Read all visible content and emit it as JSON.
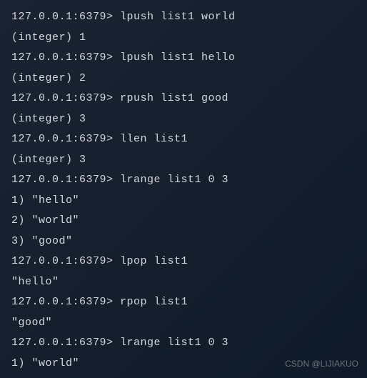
{
  "lines": [
    "127.0.0.1:6379> lpush list1 world",
    "(integer) 1",
    "127.0.0.1:6379> lpush list1 hello",
    "(integer) 2",
    "127.0.0.1:6379> rpush list1 good",
    "(integer) 3",
    "127.0.0.1:6379> llen list1",
    "(integer) 3",
    "127.0.0.1:6379> lrange list1 0 3",
    "1) \"hello\"",
    "2) \"world\"",
    "3) \"good\"",
    "127.0.0.1:6379> lpop list1",
    "\"hello\"",
    "127.0.0.1:6379> rpop list1",
    "\"good\"",
    "127.0.0.1:6379> lrange list1 0 3",
    "1) \"world\""
  ],
  "watermark": "CSDN @LIJIAKUO"
}
